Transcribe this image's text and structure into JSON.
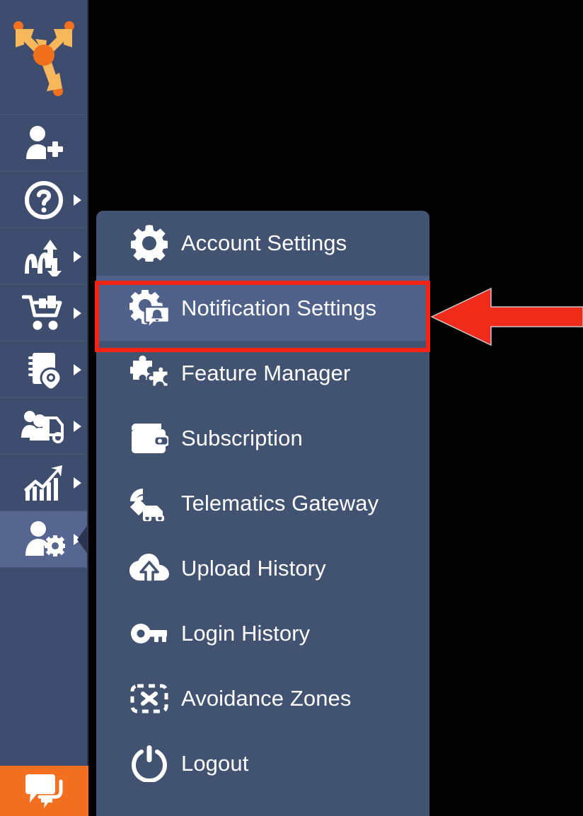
{
  "app": {
    "theme": {
      "sidebar_bg": "#3e4c6d",
      "sidebar_selected_bg": "#566690",
      "panel_bg": "#425372",
      "panel_highlight_bg": "#50618a",
      "accent_orange": "#f37021",
      "annotation_red": "#f52314",
      "text_color": "#ffffff"
    }
  },
  "sidebar": {
    "logo": {
      "name": "route-optimization-logo",
      "icon": "three-arrows-route-logo"
    },
    "items": [
      {
        "icon": "add-user-icon",
        "name": "add-user",
        "has_caret": false,
        "selected": false
      },
      {
        "icon": "question-circle-icon",
        "name": "help",
        "has_caret": true,
        "selected": false
      },
      {
        "icon": "route-arrows-icon",
        "name": "routes",
        "has_caret": true,
        "selected": false
      },
      {
        "icon": "shopping-cart-icon",
        "name": "orders",
        "has_caret": true,
        "selected": false
      },
      {
        "icon": "address-book-location-icon",
        "name": "address-book",
        "has_caret": true,
        "selected": false
      },
      {
        "icon": "team-truck-icon",
        "name": "fleet",
        "has_caret": true,
        "selected": false
      },
      {
        "icon": "growth-chart-icon",
        "name": "analytics",
        "has_caret": true,
        "selected": false
      },
      {
        "icon": "user-gear-icon",
        "name": "account",
        "has_caret": true,
        "selected": true
      }
    ],
    "chat_button": {
      "icon": "chat-bubbles-icon",
      "name": "support-chat"
    }
  },
  "menu": {
    "items": [
      {
        "label": "Account Settings",
        "icon": "gear-icon",
        "highlighted": false
      },
      {
        "label": "Notification Settings",
        "icon": "gear-notification-bell-icon",
        "highlighted": true
      },
      {
        "label": "Feature Manager",
        "icon": "puzzle-pieces-icon",
        "highlighted": false
      },
      {
        "label": "Subscription",
        "icon": "wallet-icon",
        "highlighted": false
      },
      {
        "label": "Telematics Gateway",
        "icon": "satellite-truck-icon",
        "highlighted": false
      },
      {
        "label": "Upload History",
        "icon": "cloud-upload-icon",
        "highlighted": false
      },
      {
        "label": "Login History",
        "icon": "key-icon",
        "highlighted": false
      },
      {
        "label": "Avoidance Zones",
        "icon": "dashed-box-x-icon",
        "highlighted": false
      },
      {
        "label": "Logout",
        "icon": "power-icon",
        "highlighted": false
      }
    ]
  },
  "annotation": {
    "highlight_target": "Notification Settings",
    "arrow": {
      "name": "pointer-arrow",
      "direction": "left",
      "color": "#f52314"
    },
    "box": {
      "name": "highlight-rectangle",
      "color": "#f52314"
    }
  }
}
